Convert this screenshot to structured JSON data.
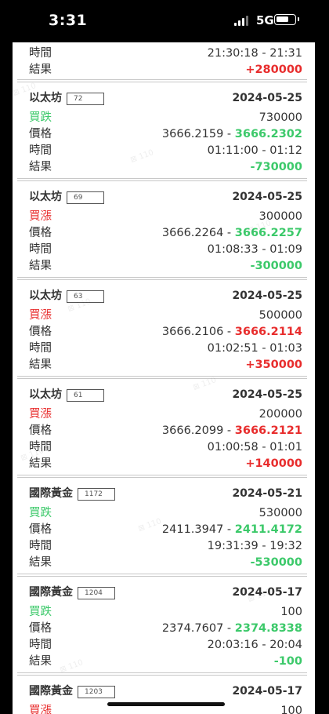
{
  "status": {
    "time": "3:31",
    "network": "5G"
  },
  "top": {
    "time_label": "時間",
    "time_value": "21:30:18 - 21:31",
    "result_label": "結果",
    "result_value": "+280000"
  },
  "labels": {
    "price": "價格",
    "time": "時間",
    "result": "結果"
  },
  "trades": [
    {
      "asset": "以太坊",
      "id": "72",
      "date": "2024-05-25",
      "direction": "買跌",
      "amount": "730000",
      "price_open": "3666.2159",
      "price_close": "3666.2302",
      "time_range": "01:11:00 - 01:12",
      "result": "-730000",
      "color": "green"
    },
    {
      "asset": "以太坊",
      "id": "69",
      "date": "2024-05-25",
      "direction": "買漲",
      "amount": "300000",
      "price_open": "3666.2264",
      "price_close": "3666.2257",
      "time_range": "01:08:33 - 01:09",
      "result": "-300000",
      "color": "red"
    },
    {
      "asset": "以太坊",
      "id": "63",
      "date": "2024-05-25",
      "direction": "買漲",
      "amount": "500000",
      "price_open": "3666.2106",
      "price_close": "3666.2114",
      "time_range": "01:02:51 - 01:03",
      "result": "+350000",
      "color": "red"
    },
    {
      "asset": "以太坊",
      "id": "61",
      "date": "2024-05-25",
      "direction": "買漲",
      "amount": "200000",
      "price_open": "3666.2099",
      "price_close": "3666.2121",
      "time_range": "01:00:58 - 01:01",
      "result": "+140000",
      "color": "red"
    },
    {
      "asset": "國際黃金",
      "id": "1172",
      "date": "2024-05-21",
      "direction": "買跌",
      "amount": "530000",
      "price_open": "2411.3947",
      "price_close": "2411.4172",
      "time_range": "19:31:39 - 19:32",
      "result": "-530000",
      "color": "green"
    },
    {
      "asset": "國際黃金",
      "id": "1204",
      "date": "2024-05-17",
      "direction": "買跌",
      "amount": "100",
      "price_open": "2374.7607",
      "price_close": "2374.8338",
      "time_range": "20:03:16 - 20:04",
      "result": "-100",
      "color": "green"
    },
    {
      "asset": "國際黃金",
      "id": "1203",
      "date": "2024-05-17",
      "direction": "買漲",
      "amount": "100",
      "color": "red"
    }
  ],
  "colors": {
    "green": "#3cc96a",
    "red": "#e82d2d"
  }
}
